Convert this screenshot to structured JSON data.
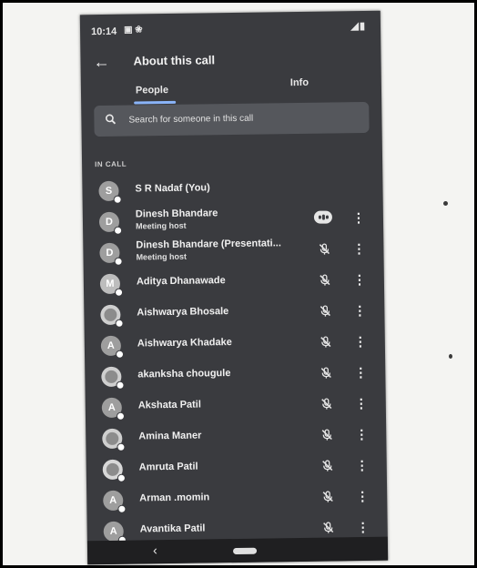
{
  "status_bar": {
    "time": "10:14",
    "icons": "▣ ❀",
    "right": "◢▮"
  },
  "header": {
    "title": "About this call",
    "back_icon": "arrow-left-icon"
  },
  "tabs": [
    {
      "label": "People",
      "selected": true
    },
    {
      "label": "Info",
      "selected": false
    }
  ],
  "search": {
    "placeholder": "Search for someone in this call",
    "icon": "search-icon"
  },
  "section_label": "IN CALL",
  "colors": {
    "accent": "#8ab4f8",
    "background": "#3a3b3f",
    "text": "#e8e8e8"
  },
  "participants": [
    {
      "initial": "S",
      "name": "S R Nadaf (You)",
      "subtitle": "",
      "avatar": "letter",
      "avatar_color": "#9e9e9e",
      "mic": "none"
    },
    {
      "initial": "D",
      "name": "Dinesh Bhandare",
      "subtitle": "Meeting host",
      "avatar": "letter",
      "avatar_color": "#9e9e9e",
      "mic": "speaking"
    },
    {
      "initial": "D",
      "name": "Dinesh Bhandare (Presentati...",
      "subtitle": "Meeting host",
      "avatar": "letter",
      "avatar_color": "#9e9e9e",
      "mic": "muted"
    },
    {
      "initial": "M",
      "name": "Aditya Dhanawade",
      "subtitle": "",
      "avatar": "photo",
      "avatar_color": "#bdbdbd",
      "mic": "muted"
    },
    {
      "initial": "",
      "name": "Aishwarya Bhosale",
      "subtitle": "",
      "avatar": "photo",
      "avatar_color": "#cfcfcf",
      "mic": "muted"
    },
    {
      "initial": "A",
      "name": "Aishwarya Khadake",
      "subtitle": "",
      "avatar": "letter",
      "avatar_color": "#9e9e9e",
      "mic": "muted"
    },
    {
      "initial": "",
      "name": "akanksha chougule",
      "subtitle": "",
      "avatar": "photo",
      "avatar_color": "#cfcfcf",
      "mic": "muted"
    },
    {
      "initial": "A",
      "name": "Akshata Patil",
      "subtitle": "",
      "avatar": "letter",
      "avatar_color": "#9e9e9e",
      "mic": "muted"
    },
    {
      "initial": "",
      "name": "Amina Maner",
      "subtitle": "",
      "avatar": "photo",
      "avatar_color": "#cfcfcf",
      "mic": "muted"
    },
    {
      "initial": "",
      "name": "Amruta Patil",
      "subtitle": "",
      "avatar": "photo",
      "avatar_color": "#d8d8d8",
      "mic": "muted"
    },
    {
      "initial": "A",
      "name": "Arman .momin",
      "subtitle": "",
      "avatar": "letter",
      "avatar_color": "#9e9e9e",
      "mic": "muted"
    },
    {
      "initial": "A",
      "name": "Avantika Patil",
      "subtitle": "",
      "avatar": "letter",
      "avatar_color": "#9e9e9e",
      "mic": "muted"
    }
  ],
  "nav_bar": {
    "back_glyph": "‹"
  }
}
